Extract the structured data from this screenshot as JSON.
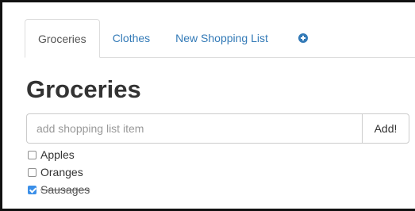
{
  "tabs": [
    {
      "label": "Groceries",
      "active": true
    },
    {
      "label": "Clothes",
      "active": false
    },
    {
      "label": "New Shopping List",
      "active": false
    }
  ],
  "add_tab_icon": "plus-circle-icon",
  "page_title": "Groceries",
  "add_item": {
    "placeholder": "add shopping list item",
    "value": "",
    "button_label": "Add!"
  },
  "items": [
    {
      "label": "Apples",
      "checked": false
    },
    {
      "label": "Oranges",
      "checked": false
    },
    {
      "label": "Sausages",
      "checked": true
    }
  ],
  "colors": {
    "link": "#337ab7",
    "checked": "#3b8fe8",
    "border": "#dddddd"
  }
}
